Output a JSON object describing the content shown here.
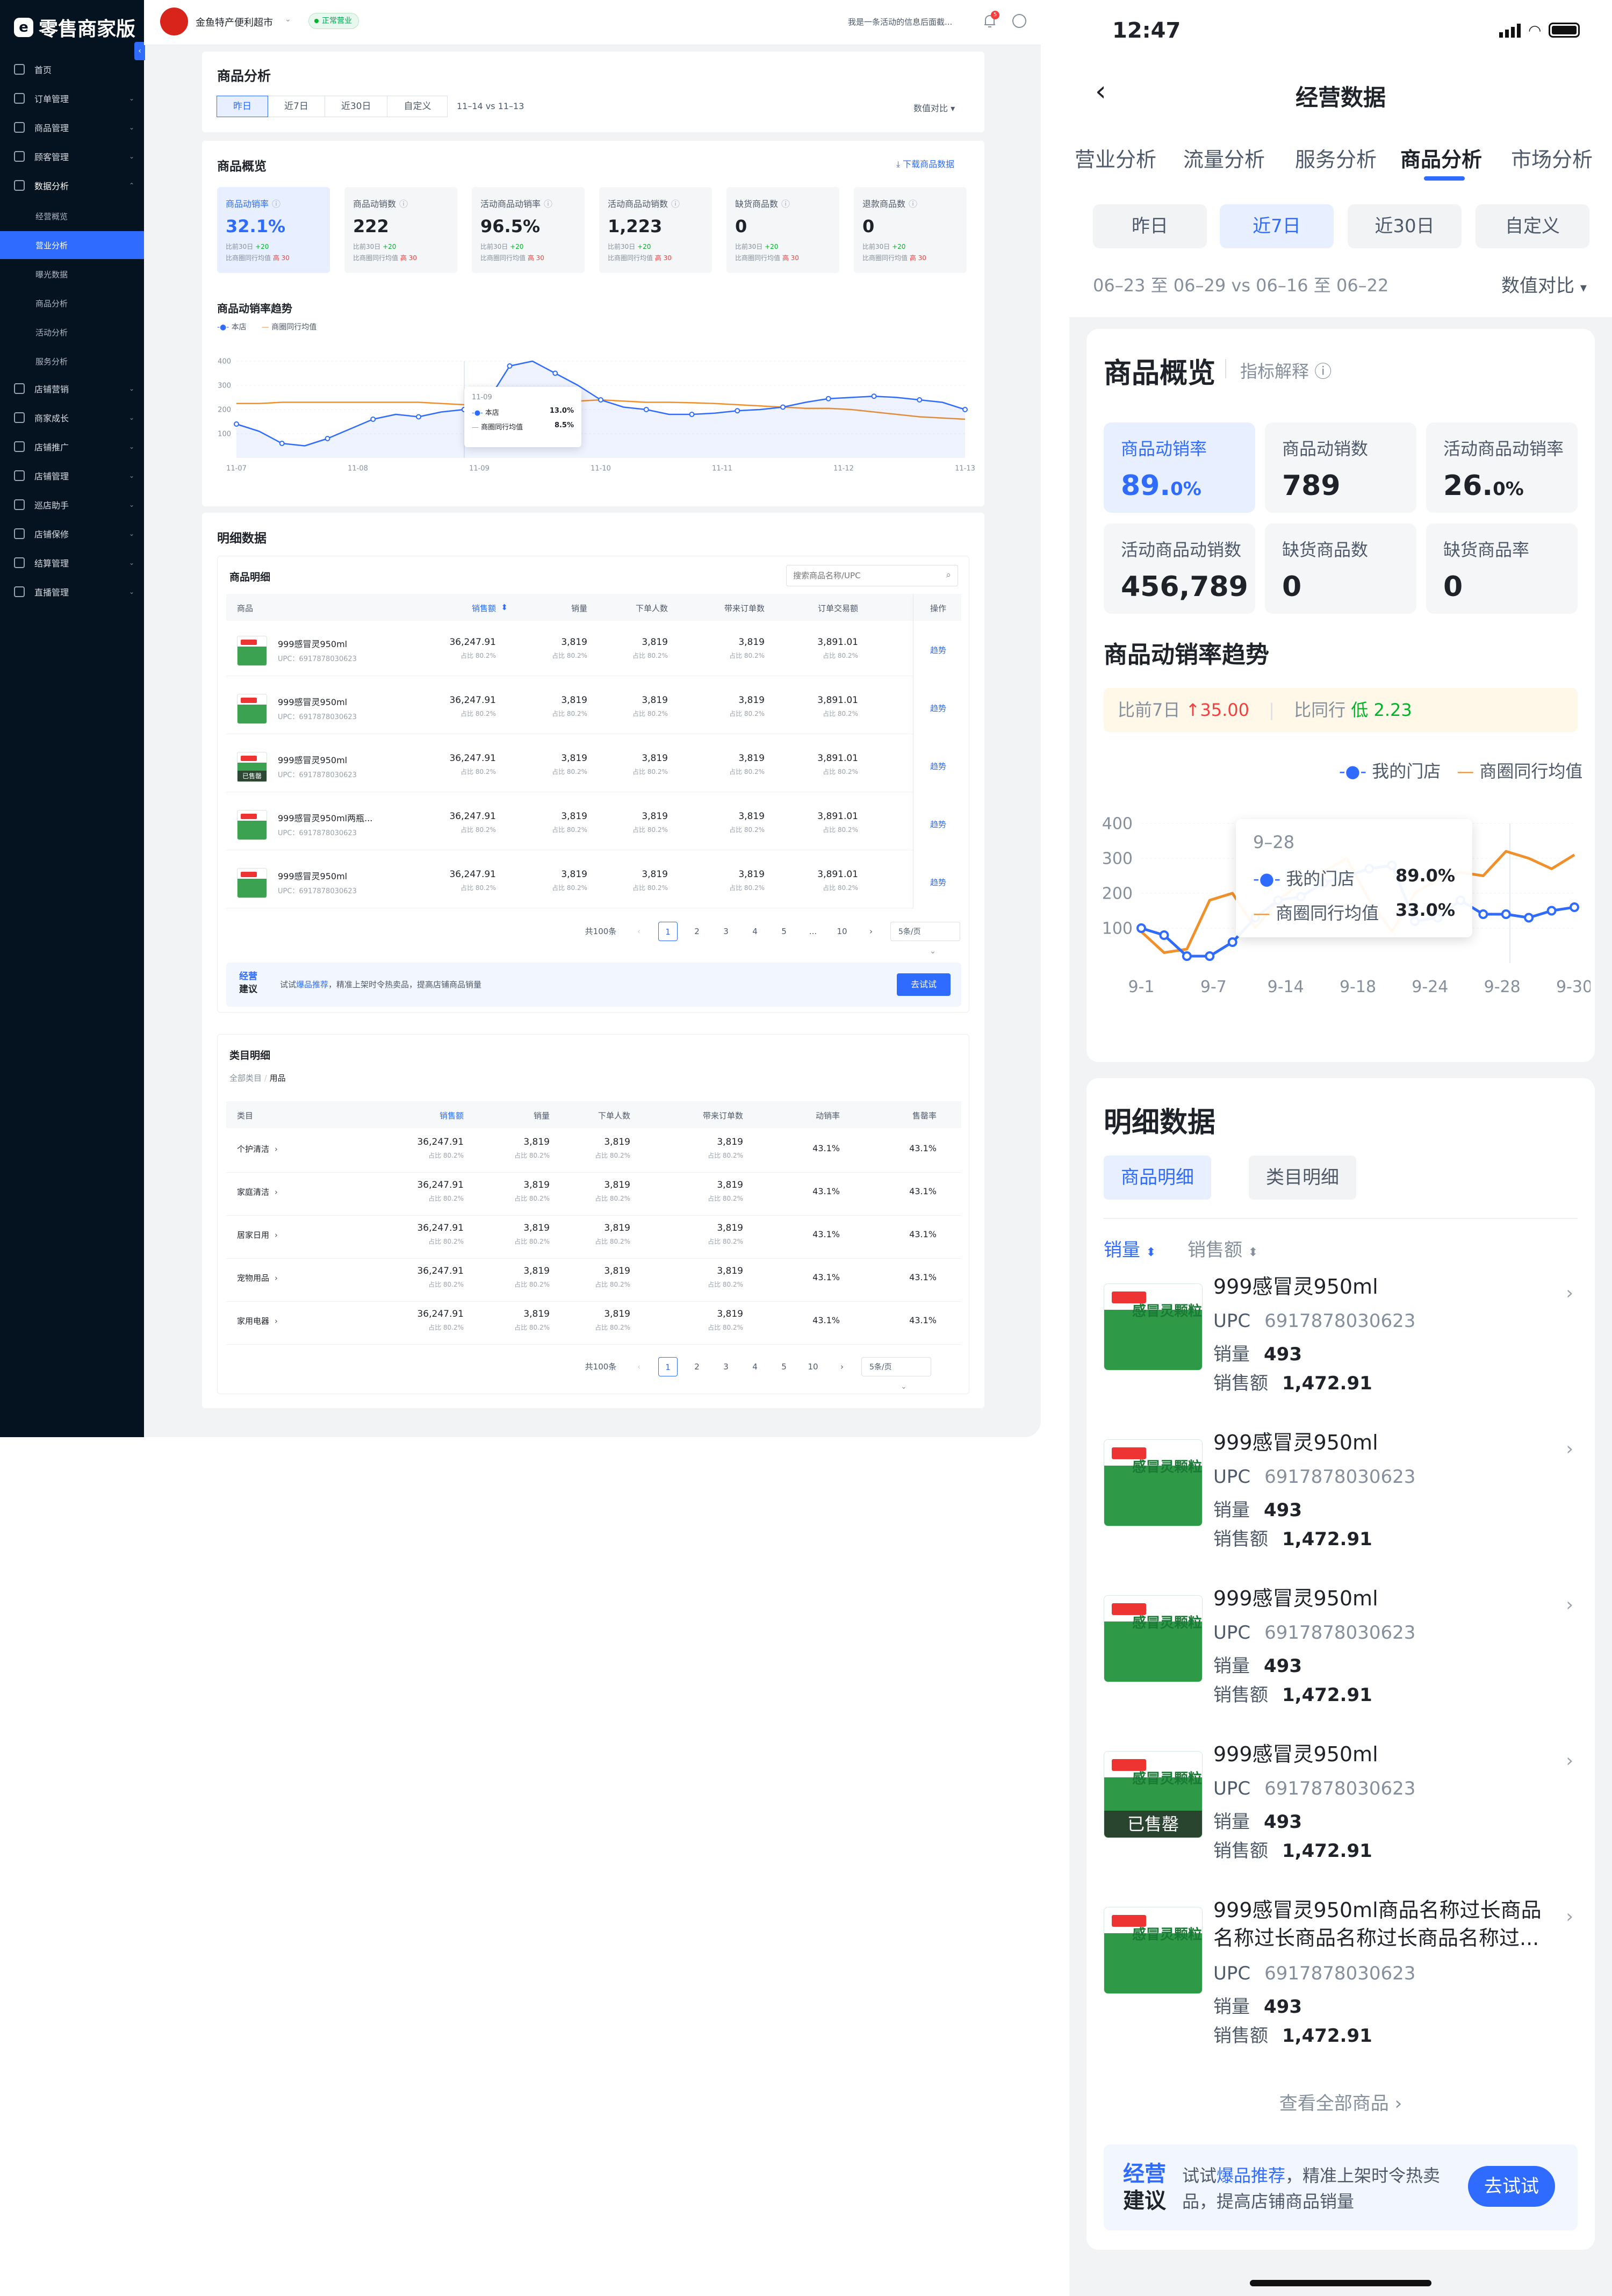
{
  "desktop": {
    "brand": "零售商家版",
    "store_name": "金鱼特产便利超市",
    "store_status": "正常营业",
    "notice": "我是一条活动的信息后面截...",
    "notify_count": "5",
    "nav": [
      {
        "label": "首页"
      },
      {
        "label": "订单管理"
      },
      {
        "label": "商品管理"
      },
      {
        "label": "顾客管理"
      },
      {
        "label": "数据分析"
      }
    ],
    "nav_sub": [
      "经营概览",
      "营业分析",
      "曝光数据",
      "商品分析",
      "活动分析",
      "服务分析"
    ],
    "nav_more": [
      "店铺营销",
      "商家成长",
      "店铺推广",
      "店铺管理",
      "巡店助手",
      "店铺保修",
      "结算管理",
      "直播管理"
    ],
    "page_title": "商品分析",
    "period_tabs": [
      "昨日",
      "近7日",
      "近30日",
      "自定义"
    ],
    "compare_range": "11–14 vs 11–13",
    "compare_label": "数值对比",
    "overview": {
      "title": "商品概览",
      "download": "下载商品数据",
      "kpis": [
        {
          "label": "商品动销率",
          "value": "32.1%",
          "cmp1": "比前30日",
          "d1": "+20",
          "cmp2": "比商圈同行均值",
          "d2": "高 30"
        },
        {
          "label": "商品动销数",
          "value": "222",
          "cmp1": "比前30日",
          "d1": "+20",
          "cmp2": "比商圈同行均值",
          "d2": "高 30"
        },
        {
          "label": "活动商品动销率",
          "value": "96.5%",
          "cmp1": "比前30日",
          "d1": "+20",
          "cmp2": "比商圈同行均值",
          "d2": "高 30"
        },
        {
          "label": "活动商品动销数",
          "value": "1,223",
          "cmp1": "比前30日",
          "d1": "+20",
          "cmp2": "比商圈同行均值",
          "d2": "高 30"
        },
        {
          "label": "缺货商品数",
          "value": "0",
          "cmp1": "比前30日",
          "d1": "+20",
          "cmp2": "比商圈同行均值",
          "d2": "高 30"
        },
        {
          "label": "退款商品数",
          "value": "0",
          "cmp1": "比前30日",
          "d1": "+20",
          "cmp2": "比商圈同行均值",
          "d2": "高 30"
        }
      ]
    },
    "trend": {
      "title": "商品动销率趋势",
      "legend_a": "本店",
      "legend_b": "商圈同行均值",
      "tooltip_date": "11-09",
      "tooltip_a": "13.0%",
      "tooltip_b": "8.5%"
    },
    "detail": {
      "title": "明细数据",
      "products_title": "商品明细",
      "search_placeholder": "搜索商品名称/UPC",
      "headers": [
        "商品",
        "销售额",
        "销量",
        "下单人数",
        "带来订单数",
        "订单交易额",
        "操作"
      ],
      "rows": [
        {
          "name": "999感冒灵950ml",
          "upc": "UPC：6917878030623",
          "sales": "36,247.91",
          "qty": "3,819",
          "buyers": "3,819",
          "orders": "3,819",
          "gmv": "3,891.01",
          "share": "占比 80.2%",
          "op": "趋势",
          "sold": ""
        },
        {
          "name": "999感冒灵950ml",
          "upc": "UPC：6917878030623",
          "sales": "36,247.91",
          "qty": "3,819",
          "buyers": "3,819",
          "orders": "3,819",
          "gmv": "3,891.01",
          "share": "占比 80.2%",
          "op": "趋势",
          "sold": ""
        },
        {
          "name": "999感冒灵950ml",
          "upc": "UPC：6917878030623",
          "sales": "36,247.91",
          "qty": "3,819",
          "buyers": "3,819",
          "orders": "3,819",
          "gmv": "3,891.01",
          "share": "占比 80.2%",
          "op": "趋势",
          "sold": "已售罄"
        },
        {
          "name": "999感冒灵950ml两瓶...",
          "upc": "UPC：6917878030623",
          "sales": "36,247.91",
          "qty": "3,819",
          "buyers": "3,819",
          "orders": "3,819",
          "gmv": "3,891.01",
          "share": "占比 80.2%",
          "op": "趋势",
          "sold": ""
        },
        {
          "name": "999感冒灵950ml",
          "upc": "UPC：6917878030623",
          "sales": "36,247.91",
          "qty": "3,819",
          "buyers": "3,819",
          "orders": "3,819",
          "gmv": "3,891.01",
          "share": "占比 80.2%",
          "op": "趋势",
          "sold": ""
        }
      ],
      "pager": {
        "total": "共100条",
        "pages": [
          "1",
          "2",
          "3",
          "4",
          "5",
          "...",
          "10"
        ],
        "size": "5条/页"
      },
      "suggest": {
        "tag1": "经营",
        "tag2": "建议",
        "pre": "试试",
        "hl": "爆品推荐",
        "post": "，精准上架时令热卖品，提高店铺商品销量",
        "btn": "去试试"
      },
      "cat_title": "类目明细",
      "cat_crumb_a": "全部类目",
      "cat_crumb_b": "用品",
      "cat_headers": [
        "类目",
        "销售额",
        "销量",
        "下单人数",
        "带来订单数",
        "动销率",
        "售罄率"
      ],
      "cat_rows": [
        {
          "name": "个护清洁",
          "sales": "36,247.91",
          "qty": "3,819",
          "buyers": "3,819",
          "orders": "3,819",
          "rate": "43.1%",
          "sell": "43.1%",
          "share": "占比 80.2%"
        },
        {
          "name": "家庭清洁",
          "sales": "36,247.91",
          "qty": "3,819",
          "buyers": "3,819",
          "orders": "3,819",
          "rate": "43.1%",
          "sell": "43.1%",
          "share": "占比 80.2%"
        },
        {
          "name": "居家日用",
          "sales": "36,247.91",
          "qty": "3,819",
          "buyers": "3,819",
          "orders": "3,819",
          "rate": "43.1%",
          "sell": "43.1%",
          "share": "占比 80.2%"
        },
        {
          "name": "宠物用品",
          "sales": "36,247.91",
          "qty": "3,819",
          "buyers": "3,819",
          "orders": "3,819",
          "rate": "43.1%",
          "sell": "43.1%",
          "share": "占比 80.2%"
        },
        {
          "name": "家用电器",
          "sales": "36,247.91",
          "qty": "3,819",
          "buyers": "3,819",
          "orders": "3,819",
          "rate": "43.1%",
          "sell": "43.1%",
          "share": "占比 80.2%"
        }
      ]
    }
  },
  "mobile": {
    "time": "12:47",
    "title": "经营数据",
    "tabs": [
      "营业分析",
      "流量分析",
      "服务分析",
      "商品分析",
      "市场分析"
    ],
    "periods": [
      "昨日",
      "近7日",
      "近30日",
      "自定义"
    ],
    "range": "06–23 至 06–29  vs  06–16 至 06–22",
    "compare": "数值对比",
    "overview_title": "商品概览",
    "overview_hint": "指标解释",
    "kpis": [
      {
        "label": "商品动销率",
        "value": "89.",
        "unit": "0%"
      },
      {
        "label": "商品动销数",
        "value": "789",
        "unit": ""
      },
      {
        "label": "活动商品动销率",
        "value": "26.",
        "unit": "0%"
      },
      {
        "label": "活动商品动销数",
        "value": "456,789",
        "unit": ""
      },
      {
        "label": "缺货商品数",
        "value": "0",
        "unit": ""
      },
      {
        "label": "缺货商品率",
        "value": "0",
        "unit": ""
      }
    ],
    "trend_title": "商品动销率趋势",
    "trend_cmp_a": "比前7日",
    "trend_cmp_a_val": "35.00",
    "trend_cmp_b": "比同行",
    "trend_cmp_b_val": "低 2.23",
    "legend_a": "我的门店",
    "legend_b": "商圈同行均值",
    "tooltip": {
      "date": "9–28",
      "a_label": "我的门店",
      "a_val": "89.0%",
      "b_label": "商圈同行均值",
      "b_val": "33.0%"
    },
    "detail_title": "明细数据",
    "detail_tabs": [
      "商品明细",
      "类目明细"
    ],
    "sort_a": "销量",
    "sort_b": "销售额",
    "items": [
      {
        "name": "999感冒灵950ml",
        "upc_label": "UPC",
        "upc": "6917878030623",
        "qty_label": "销量",
        "qty": "493",
        "sales_label": "销售额",
        "sales": "1,472.91",
        "sold": ""
      },
      {
        "name": "999感冒灵950ml",
        "upc_label": "UPC",
        "upc": "6917878030623",
        "qty_label": "销量",
        "qty": "493",
        "sales_label": "销售额",
        "sales": "1,472.91",
        "sold": ""
      },
      {
        "name": "999感冒灵950ml",
        "upc_label": "UPC",
        "upc": "6917878030623",
        "qty_label": "销量",
        "qty": "493",
        "sales_label": "销售额",
        "sales": "1,472.91",
        "sold": ""
      },
      {
        "name": "999感冒灵950ml",
        "upc_label": "UPC",
        "upc": "6917878030623",
        "qty_label": "销量",
        "qty": "493",
        "sales_label": "销售额",
        "sales": "1,472.91",
        "sold": "已售罄"
      },
      {
        "name": "999感冒灵950ml商品名称过长商品名称过长商品名称过长商品名称过...",
        "upc_label": "UPC",
        "upc": "6917878030623",
        "qty_label": "销量",
        "qty": "493",
        "sales_label": "销售额",
        "sales": "1,472.91",
        "sold": ""
      }
    ],
    "view_all": "查看全部商品",
    "suggest": {
      "tag1": "经营",
      "tag2": "建议",
      "pre": "试试",
      "hl": "爆品推荐",
      "post": "，精准上架时令热卖品，提高店铺商品销量",
      "btn": "去试试"
    }
  },
  "chart_data": [
    {
      "type": "line",
      "title": "商品动销率趋势",
      "x": [
        "11-07",
        "11-08",
        "11-09",
        "11-10",
        "11-11",
        "11-12",
        "11-13"
      ],
      "ylim": [
        0,
        400
      ],
      "yticks": [
        100,
        200,
        300,
        400
      ],
      "series": [
        {
          "name": "本店",
          "color": "#2f6bff",
          "values": [
            140,
            110,
            60,
            50,
            80,
            120,
            160,
            180,
            170,
            190,
            200,
            230,
            380,
            400,
            350,
            300,
            240,
            210,
            200,
            180,
            180,
            185,
            195,
            200,
            210,
            230,
            245,
            250,
            255,
            250,
            240,
            230,
            200
          ]
        },
        {
          "name": "商圈同行均值",
          "color": "#f0902a",
          "values": [
            225,
            225,
            230,
            230,
            230,
            230,
            230,
            230,
            230,
            225,
            220,
            220,
            220,
            225,
            230,
            235,
            240,
            235,
            230,
            230,
            228,
            225,
            220,
            215,
            210,
            205,
            205,
            200,
            190,
            180,
            170,
            165,
            160
          ]
        }
      ]
    },
    {
      "type": "line",
      "title": "商品动销率趋势",
      "x": [
        "9-1",
        "9-7",
        "9-14",
        "9-18",
        "9-24",
        "9-28",
        "9-30"
      ],
      "ylim": [
        0,
        400
      ],
      "yticks": [
        100,
        200,
        300,
        400
      ],
      "series": [
        {
          "name": "我的门店",
          "color": "#2f6bff",
          "values": [
            100,
            80,
            20,
            20,
            60,
            130,
            180,
            190,
            230,
            250,
            270,
            280,
            120,
            130,
            180,
            140,
            140,
            130,
            150,
            160
          ]
        },
        {
          "name": "商圈同行均值",
          "color": "#f0902a",
          "values": [
            90,
            30,
            40,
            180,
            200,
            100,
            180,
            230,
            260,
            300,
            180,
            90,
            200,
            240,
            260,
            250,
            320,
            300,
            270,
            310
          ]
        }
      ]
    }
  ]
}
